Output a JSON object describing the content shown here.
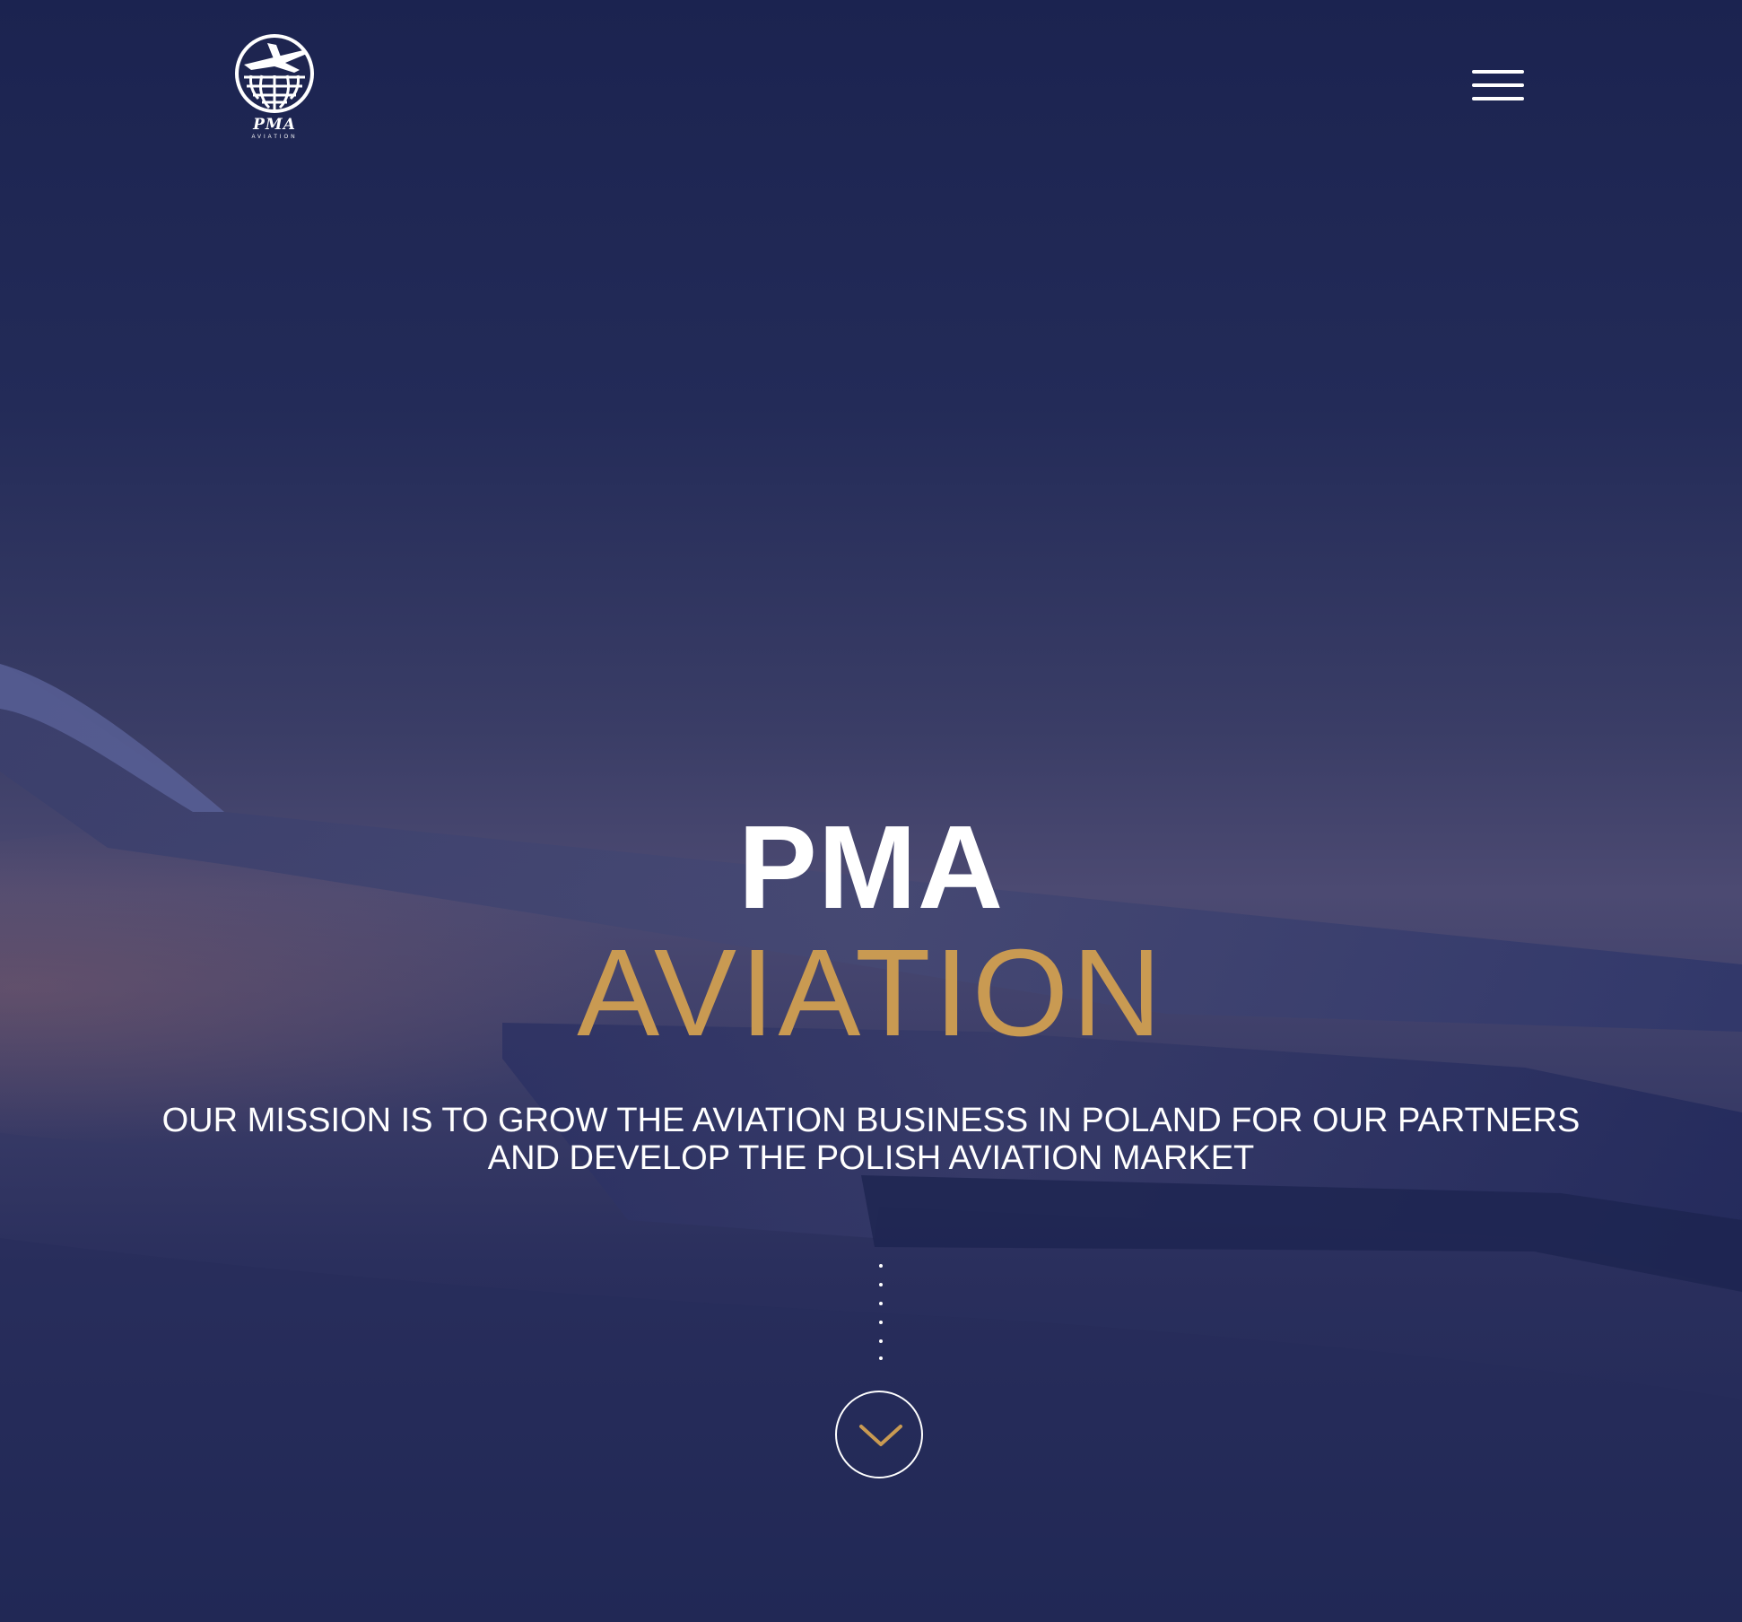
{
  "logo": {
    "wordmark": "PMA",
    "subtext": "AVIATION"
  },
  "nav": {
    "menu_icon": "hamburger-menu-icon"
  },
  "hero": {
    "title_main": "PMA",
    "title_sub": "AVIATION",
    "mission_line1": "OUR MISSION IS TO GROW THE AVIATION BUSINESS IN POLAND FOR OUR PARTNERS",
    "mission_line2": "AND DEVELOP THE POLISH AVIATION MARKET",
    "scroll_icon": "chevron-down-icon"
  },
  "colors": {
    "background": "#1e2550",
    "accent_gold": "#c99a52",
    "text_white": "#ffffff"
  }
}
